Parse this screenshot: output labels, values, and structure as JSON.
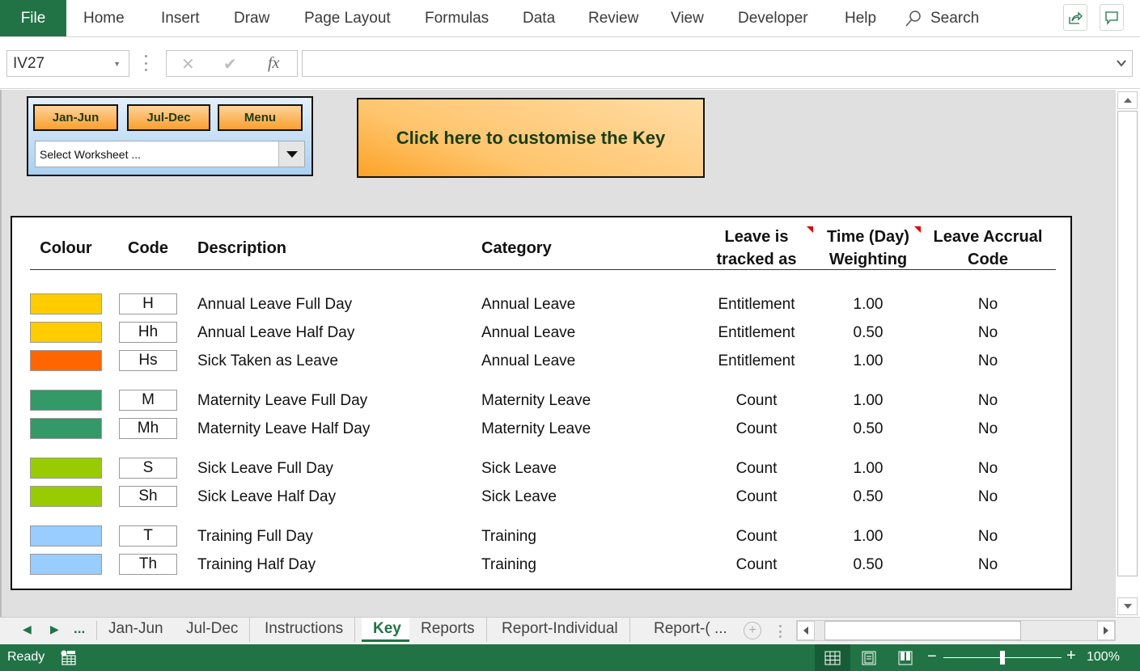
{
  "ribbon": {
    "file_label": "File",
    "tabs": [
      "Home",
      "Insert",
      "Draw",
      "Page Layout",
      "Formulas",
      "Data",
      "Review",
      "View",
      "Developer",
      "Help"
    ],
    "search_label": "Search"
  },
  "formula_bar": {
    "name_box": "IV27",
    "cancel_glyph": "✕",
    "enter_glyph": "✔",
    "fx_glyph": "fx",
    "formula": ""
  },
  "nav_panel": {
    "buttons": [
      "Jan-Jun",
      "Jul-Dec",
      "Menu"
    ],
    "worksheet_select": "Select Worksheet ..."
  },
  "customise_button": "Click here to customise the Key",
  "key_table": {
    "headers": {
      "colour": "Colour",
      "code": "Code",
      "description": "Description",
      "category": "Category",
      "tracked_1": "Leave is",
      "tracked_2": "tracked as",
      "weight_1": "Time (Day)",
      "weight_2": "Weighting",
      "accrual_1": "Leave Accrual",
      "accrual_2": "Code"
    },
    "rows": [
      {
        "colour": "#ffcc00",
        "code": "H",
        "description": "Annual Leave Full Day",
        "category": "Annual Leave",
        "tracked": "Entitlement",
        "weighting": "1.00",
        "accrual": "No"
      },
      {
        "colour": "#ffcc00",
        "code": "Hh",
        "description": "Annual Leave Half Day",
        "category": "Annual Leave",
        "tracked": "Entitlement",
        "weighting": "0.50",
        "accrual": "No"
      },
      {
        "colour": "#ff6600",
        "code": "Hs",
        "description": "Sick Taken as Leave",
        "category": "Annual Leave",
        "tracked": "Entitlement",
        "weighting": "1.00",
        "accrual": "No"
      },
      {
        "colour": "#339966",
        "code": "M",
        "description": "Maternity Leave Full Day",
        "category": "Maternity Leave",
        "tracked": "Count",
        "weighting": "1.00",
        "accrual": "No"
      },
      {
        "colour": "#339966",
        "code": "Mh",
        "description": "Maternity Leave Half Day",
        "category": "Maternity Leave",
        "tracked": "Count",
        "weighting": "0.50",
        "accrual": "No"
      },
      {
        "colour": "#99cc00",
        "code": "S",
        "description": "Sick Leave Full Day",
        "category": "Sick Leave",
        "tracked": "Count",
        "weighting": "1.00",
        "accrual": "No"
      },
      {
        "colour": "#99cc00",
        "code": "Sh",
        "description": "Sick Leave Half Day",
        "category": "Sick Leave",
        "tracked": "Count",
        "weighting": "0.50",
        "accrual": "No"
      },
      {
        "colour": "#99ccff",
        "code": "T",
        "description": "Training Full Day",
        "category": "Training",
        "tracked": "Count",
        "weighting": "1.00",
        "accrual": "No"
      },
      {
        "colour": "#99ccff",
        "code": "Th",
        "description": "Training Half Day",
        "category": "Training",
        "tracked": "Count",
        "weighting": "0.50",
        "accrual": "No"
      }
    ]
  },
  "sheet_tabs": {
    "more": "...",
    "tabs": [
      "Jan-Jun",
      "Jul-Dec",
      "Instructions",
      "Key",
      "Reports",
      "Report-Individual",
      "Report-( ..."
    ],
    "active": "Key"
  },
  "status_bar": {
    "ready": "Ready",
    "zoom": "100%",
    "zoom_level_percent": 100
  }
}
